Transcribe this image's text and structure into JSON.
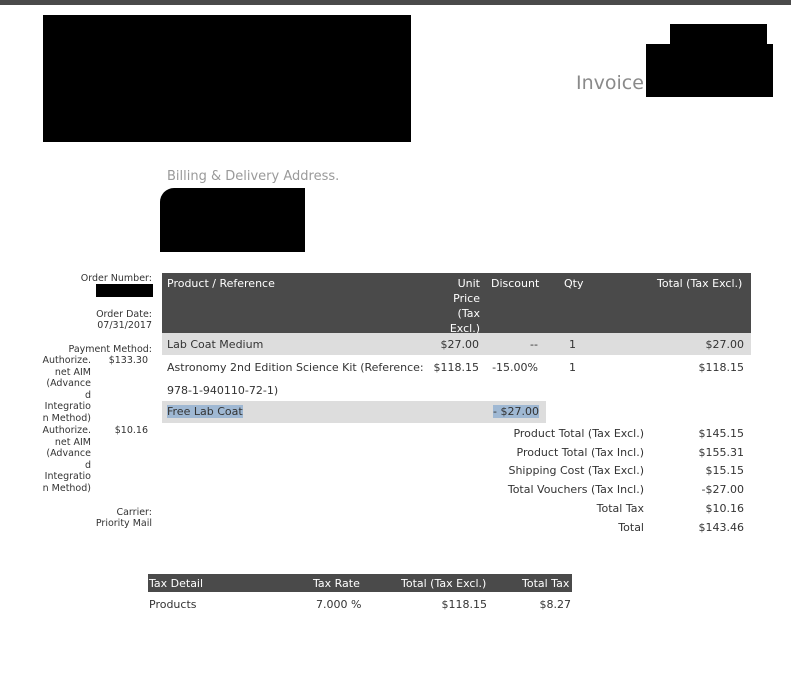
{
  "header": {
    "invoice_label": "Invoice"
  },
  "billing": {
    "label": "Billing & Delivery Address."
  },
  "order": {
    "number_label": "Order Number:",
    "date_label": "Order Date:",
    "date_value": "07/31/2017",
    "payment_label": "Payment Method:",
    "payments": [
      {
        "method_lines": [
          "Authorize.",
          "net AIM",
          "(Advance",
          "d",
          "Integratio",
          "n Method)"
        ],
        "amount": "$133.30"
      },
      {
        "method_lines": [
          "Authorize.",
          "net AIM",
          "(Advance",
          "d",
          "Integratio",
          "n Method)"
        ],
        "amount": "$10.16"
      }
    ],
    "carrier_label": "Carrier:",
    "carrier_value": "Priority Mail"
  },
  "products_table": {
    "headers": {
      "product": "Product / Reference",
      "unit_price_lines": [
        "Unit",
        "Price",
        "(Tax",
        "Excl.)"
      ],
      "discount": "Discount",
      "qty": "Qty",
      "total": "Total (Tax Excl.)"
    },
    "rows": [
      {
        "product": "Lab Coat Medium",
        "unit_price": "$27.00",
        "discount": "--",
        "qty": "1",
        "total": "$27.00"
      },
      {
        "product_line1": "Astronomy 2nd Edition Science Kit (Reference:",
        "product_line2": "978-1-940110-72-1)",
        "unit_price": "$118.15",
        "discount": "-15.00%",
        "qty": "1",
        "total": "$118.15"
      }
    ],
    "voucher": {
      "name": "Free Lab Coat",
      "amount": "- $27.00"
    }
  },
  "totals": [
    {
      "label": "Product Total (Tax Excl.)",
      "value": "$145.15"
    },
    {
      "label": "Product Total (Tax Incl.)",
      "value": "$155.31"
    },
    {
      "label": "Shipping Cost (Tax Excl.)",
      "value": "$15.15"
    },
    {
      "label": "Total Vouchers (Tax Incl.)",
      "value": "-$27.00"
    },
    {
      "label": "Total Tax",
      "value": "$10.16"
    },
    {
      "label": "Total",
      "value": "$143.46"
    }
  ],
  "tax_table": {
    "headers": {
      "detail": "Tax Detail",
      "rate": "Tax Rate",
      "total_excl": "Total (Tax Excl.)",
      "total_tax": "Total Tax"
    },
    "rows": [
      {
        "detail": "Products",
        "rate": "7.000 %",
        "total_excl": "$118.15",
        "total_tax": "$8.27"
      }
    ]
  }
}
